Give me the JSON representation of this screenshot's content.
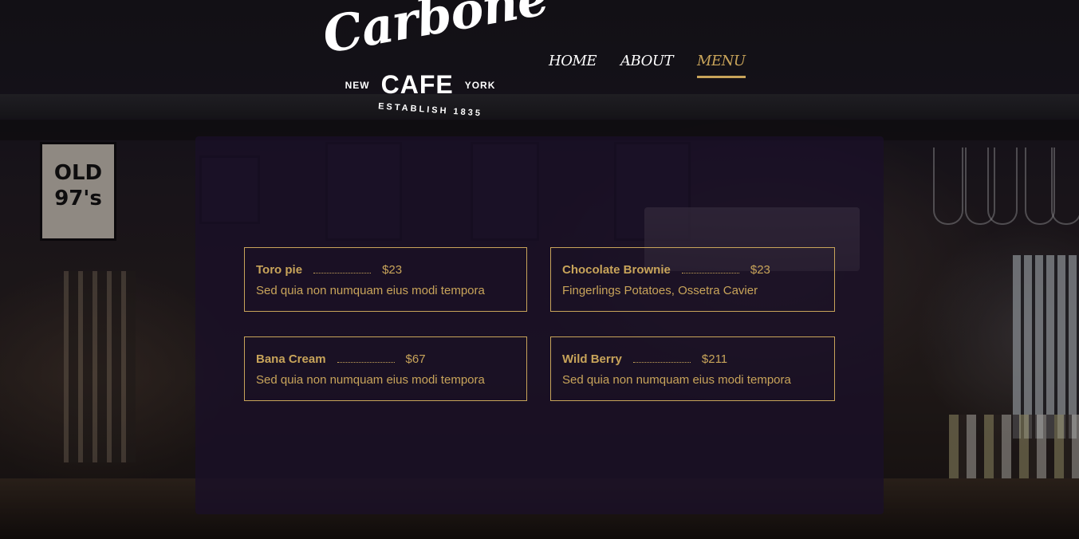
{
  "brand": {
    "script": "Carbone",
    "city_left": "NEW",
    "cafe": "CAFE",
    "city_right": "YORK",
    "established": "ESTABLISH 1835"
  },
  "nav": {
    "items": [
      {
        "label": "HOME"
      },
      {
        "label": "ABOUT"
      },
      {
        "label": "MENU",
        "active": true
      }
    ]
  },
  "menu": {
    "items": [
      {
        "name": "Toro pie",
        "price": "$23",
        "description": "Sed quia non numquam eius modi tempora"
      },
      {
        "name": "Chocolate Brownie",
        "price": "$23",
        "description": "Fingerlings Potatoes, Ossetra Cavier"
      },
      {
        "name": "Bana Cream",
        "price": "$67",
        "description": "Sed quia non numquam eius modi tempora"
      },
      {
        "name": "Wild Berry",
        "price": "$211",
        "description": "Sed quia non numquam eius modi tempora"
      }
    ]
  },
  "colors": {
    "accent": "#c8a45a",
    "panel": "#1a1028",
    "nav_text": "#ffffff"
  }
}
